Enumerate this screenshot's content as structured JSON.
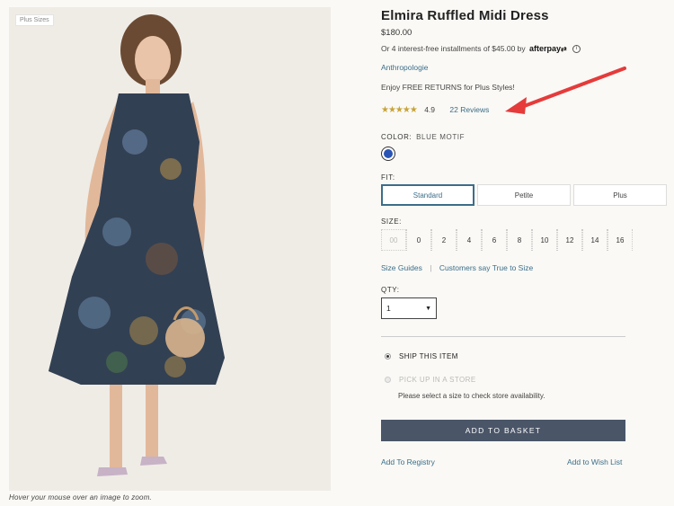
{
  "image": {
    "badge": "Plus Sizes",
    "zoom_hint": "Hover your mouse over an image to zoom."
  },
  "product": {
    "title": "Elmira Ruffled Midi Dress",
    "price": "$180.00",
    "installments_text": "Or 4 interest-free installments of $45.00 by",
    "afterpay_logo": "afterpay",
    "info_icon": "i",
    "brand": "Anthropologie",
    "returns_text": "Enjoy FREE RETURNS for Plus Styles!",
    "stars": "★★★★★",
    "rating": "4.9",
    "reviews_link": "22 Reviews"
  },
  "color": {
    "label": "COLOR:",
    "value": "BLUE MOTIF",
    "swatch_hex": "#2a55b5"
  },
  "fit": {
    "label": "FIT:",
    "options": [
      "Standard",
      "Petite",
      "Plus"
    ],
    "selected": "Standard"
  },
  "size": {
    "label": "SIZE:",
    "options": [
      "00",
      "0",
      "2",
      "4",
      "6",
      "8",
      "10",
      "12",
      "14",
      "16"
    ],
    "unavailable": [
      "00"
    ]
  },
  "links": {
    "size_guides": "Size Guides",
    "separator": "|",
    "true_to_size": "Customers say True to Size",
    "registry": "Add To Registry",
    "wishlist": "Add to Wish List"
  },
  "qty": {
    "label": "QTY:",
    "value": "1"
  },
  "delivery": {
    "ship": "SHIP THIS ITEM",
    "pickup": "PICK UP IN A STORE",
    "pickup_note": "Please select a size to check store availability."
  },
  "cta": {
    "add_to_basket": "ADD TO BASKET"
  },
  "colors": {
    "link": "#3b6e8a",
    "button": "#4a5568",
    "arrow": "#e53b3b",
    "stars": "#c8a33a"
  }
}
